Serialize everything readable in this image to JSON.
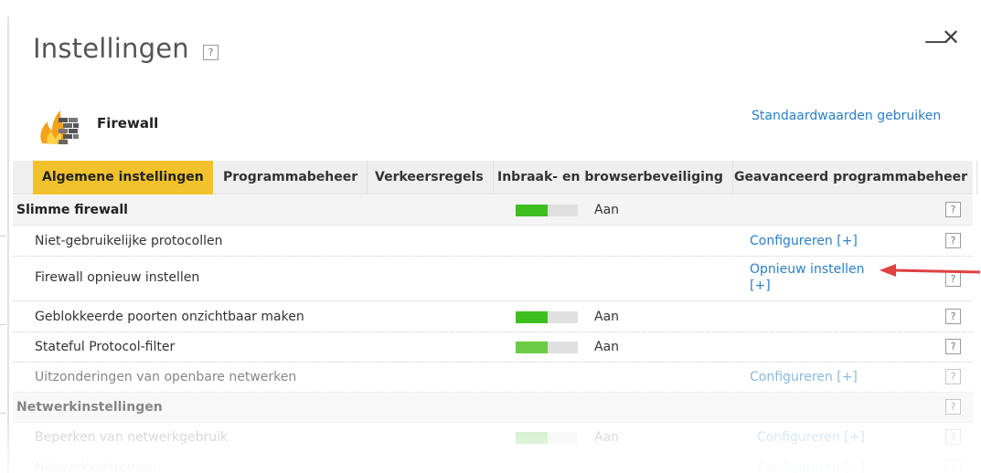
{
  "window": {
    "title": "Instellingen",
    "help_glyph": "?",
    "minimize_glyph": "—",
    "close_glyph": "✕"
  },
  "module": {
    "name": "Firewall",
    "icon": "firewall-flame-icon",
    "defaults_link": "Standaardwaarden gebruiken"
  },
  "tabs": [
    {
      "label": "Algemene instellingen",
      "active": true
    },
    {
      "label": "Programmabeheer"
    },
    {
      "label": "Verkeersregels"
    },
    {
      "label": "Inbraak- en browserbeveiliging"
    },
    {
      "label": "Geavanceerd programmabeheer"
    }
  ],
  "rows": [
    {
      "label": "Slimme firewall",
      "state": "Aan",
      "link": "",
      "help": "?"
    },
    {
      "label": "Niet-gebruikelijke protocollen",
      "state": "",
      "link": "Configureren [+]",
      "help": "?"
    },
    {
      "label": "Firewall opnieuw instellen",
      "state": "",
      "link": "Opnieuw instellen [+]",
      "help": "?"
    },
    {
      "label": "Geblokkeerde poorten onzichtbaar maken",
      "state": "Aan",
      "link": "",
      "help": "?"
    },
    {
      "label": "Stateful Protocol-filter",
      "state": "Aan",
      "link": "",
      "help": "?"
    },
    {
      "label": "Uitzonderingen van openbare netwerken",
      "state": "",
      "link": "Configureren [+]",
      "help": "?"
    },
    {
      "label": "Netwerkinstellingen",
      "state": "",
      "link": "",
      "help": "?"
    },
    {
      "label": "Beperken van netwerkgebruik",
      "state": "Aan",
      "link": "Configureren [+]",
      "help": "?"
    },
    {
      "label": "Netwerkvertrouwen",
      "state": "",
      "link": "Configureren [+]",
      "help": "?"
    }
  ],
  "colors": {
    "accent_tab": "#f2c22c",
    "toggle_on": "#3fbf1f",
    "link": "#2a7fc9",
    "arrow": "#e04040"
  }
}
